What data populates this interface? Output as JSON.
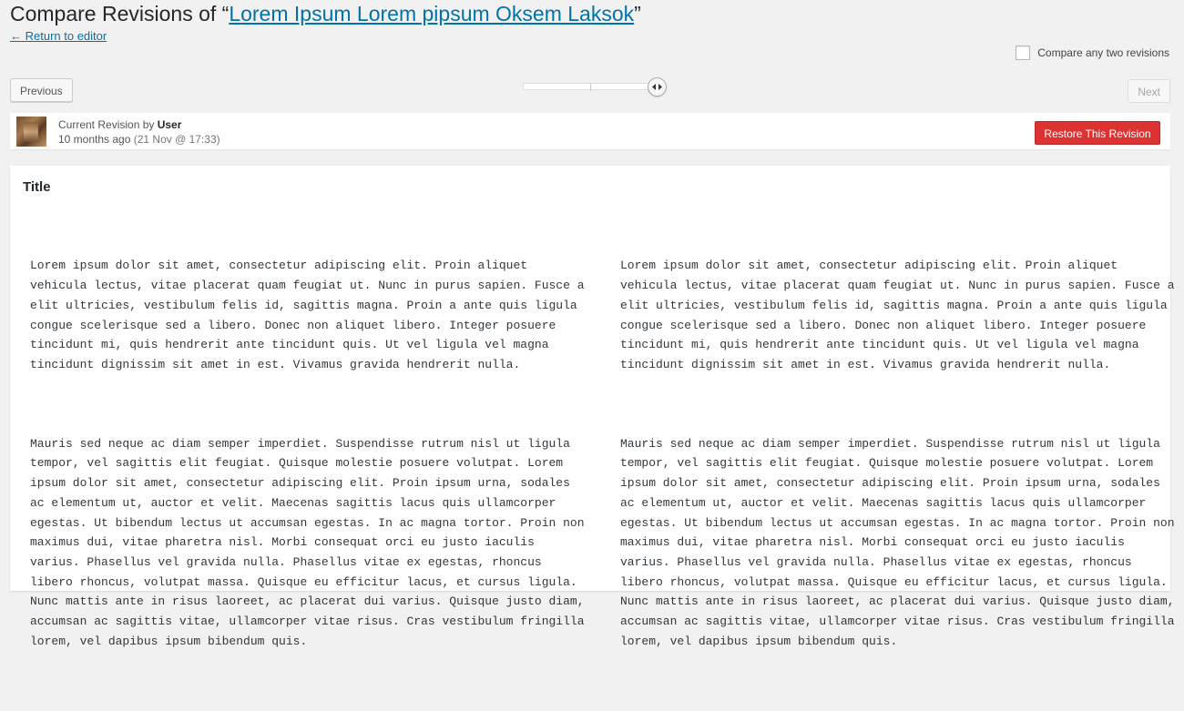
{
  "header": {
    "title_prefix": "Compare Revisions of “",
    "title_link": "Lorem Ipsum Lorem pipsum Oksem Laksok",
    "title_suffix": "”",
    "return_link": "← Return to editor"
  },
  "controls": {
    "compare_any_label": "Compare any two revisions",
    "previous_label": "Previous",
    "next_label": "Next"
  },
  "revision": {
    "prefix": "Current Revision by ",
    "author": "User",
    "relative_time": "10 months ago",
    "date": "(21 Nov @ 17:33)",
    "restore_label": "Restore This Revision"
  },
  "diff": {
    "title": "Title",
    "left": {
      "p1": "Lorem ipsum dolor sit amet, consectetur adipiscing elit. Proin aliquet\nvehicula lectus, vitae placerat quam feugiat ut. Nunc in purus sapien. Fusce a\nelit ultricies, vestibulum felis id, sagittis magna. Proin a ante quis ligula\ncongue scelerisque sed a libero. Donec non aliquet libero. Integer posuere\ntincidunt mi, quis hendrerit ante tincidunt quis. Ut vel ligula vel magna\ntincidunt dignissim sit amet in est. Vivamus gravida hendrerit nulla.",
      "p2": "Mauris sed neque ac diam semper imperdiet. Suspendisse rutrum nisl ut ligula\ntempor, vel sagittis elit feugiat. Quisque molestie posuere volutpat. Lorem\nipsum dolor sit amet, consectetur adipiscing elit. Proin ipsum urna, sodales\nac elementum ut, auctor et velit. Maecenas sagittis lacus quis ullamcorper\negestas. Ut bibendum lectus ut accumsan egestas. In ac magna tortor. Proin non\nmaximus dui, vitae pharetra nisl. Morbi consequat orci eu justo iaculis\nvarius. Phasellus vel gravida nulla. Phasellus vitae ex egestas, rhoncus\nlibero rhoncus, volutpat massa. Quisque eu efficitur lacus, et cursus ligula.\nNunc mattis ante in risus laoreet, ac placerat dui varius. Quisque justo diam,\naccumsan ac sagittis vitae, ullamcorper vitae risus. Cras vestibulum fringilla\nlorem, vel dapibus ipsum bibendum quis."
    },
    "right": {
      "p1": "Lorem ipsum dolor sit amet, consectetur adipiscing elit. Proin aliquet\nvehicula lectus, vitae placerat quam feugiat ut. Nunc in purus sapien. Fusce a\nelit ultricies, vestibulum felis id, sagittis magna. Proin a ante quis ligula\ncongue scelerisque sed a libero. Donec non aliquet libero. Integer posuere\ntincidunt mi, quis hendrerit ante tincidunt quis. Ut vel ligula vel magna\ntincidunt dignissim sit amet in est. Vivamus gravida hendrerit nulla.",
      "p2": "Mauris sed neque ac diam semper imperdiet. Suspendisse rutrum nisl ut ligula\ntempor, vel sagittis elit feugiat. Quisque molestie posuere volutpat. Lorem\nipsum dolor sit amet, consectetur adipiscing elit. Proin ipsum urna, sodales\nac elementum ut, auctor et velit. Maecenas sagittis lacus quis ullamcorper\negestas. Ut bibendum lectus ut accumsan egestas. In ac magna tortor. Proin non\nmaximus dui, vitae pharetra nisl. Morbi consequat orci eu justo iaculis\nvarius. Phasellus vel gravida nulla. Phasellus vitae ex egestas, rhoncus\nlibero rhoncus, volutpat massa. Quisque eu efficitur lacus, et cursus ligula.\nNunc mattis ante in risus laoreet, ac placerat dui varius. Quisque justo diam,\naccumsan ac sagittis vitae, ullamcorper vitae risus. Cras vestibulum fringilla\nlorem, vel dapibus ipsum bibendum quis."
    }
  },
  "colors": {
    "link": "#0073aa",
    "restore_button": "#dc3232",
    "background": "#f1f1f1"
  },
  "icons": {
    "slider_handle": "left-right-arrows-icon",
    "avatar": "user-avatar"
  }
}
